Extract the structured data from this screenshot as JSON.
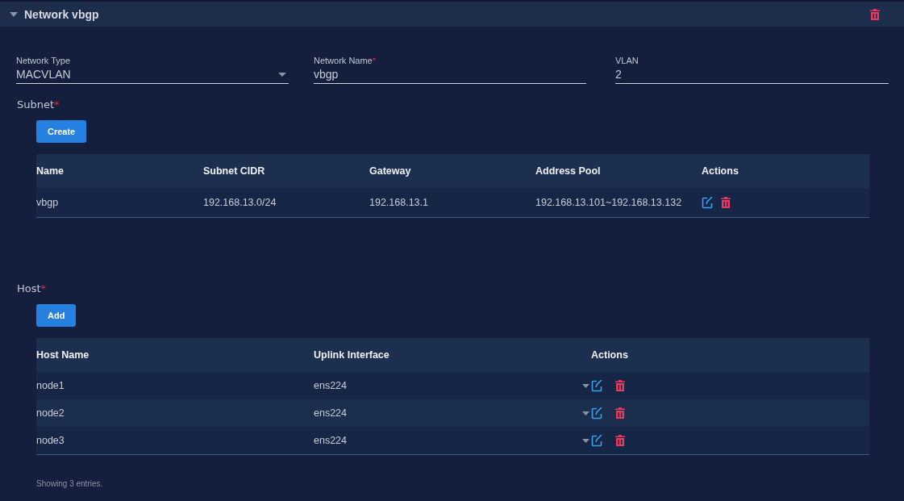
{
  "panel": {
    "title": "Network vbgp",
    "expanded": true
  },
  "fields": [
    {
      "label": "Network Type",
      "value": "MACVLAN",
      "kind": "select"
    },
    {
      "label": "Network Name",
      "required_mark": "*",
      "value": "vbgp",
      "kind": "text"
    },
    {
      "label": "VLAN",
      "value": "2",
      "kind": "text"
    }
  ],
  "subnet": {
    "label": "Subnet",
    "required_mark": "*",
    "button": "Create",
    "columns": [
      "Name",
      "Subnet CIDR",
      "Gateway",
      "Address Pool",
      "Actions"
    ],
    "rows": [
      [
        "vbgp",
        "192.168.13.0/24",
        "192.168.13.1",
        "192.168.13.101~192.168.13.132"
      ]
    ]
  },
  "host": {
    "label": "Host",
    "required_mark": "*",
    "button": "Add",
    "columns": [
      "Host Name",
      "Uplink Interface",
      "Actions"
    ],
    "rows": [
      [
        "node1",
        "ens224"
      ],
      [
        "node2",
        "ens224"
      ],
      [
        "node3",
        "ens224"
      ]
    ],
    "footer": "Showing 3 entries."
  }
}
